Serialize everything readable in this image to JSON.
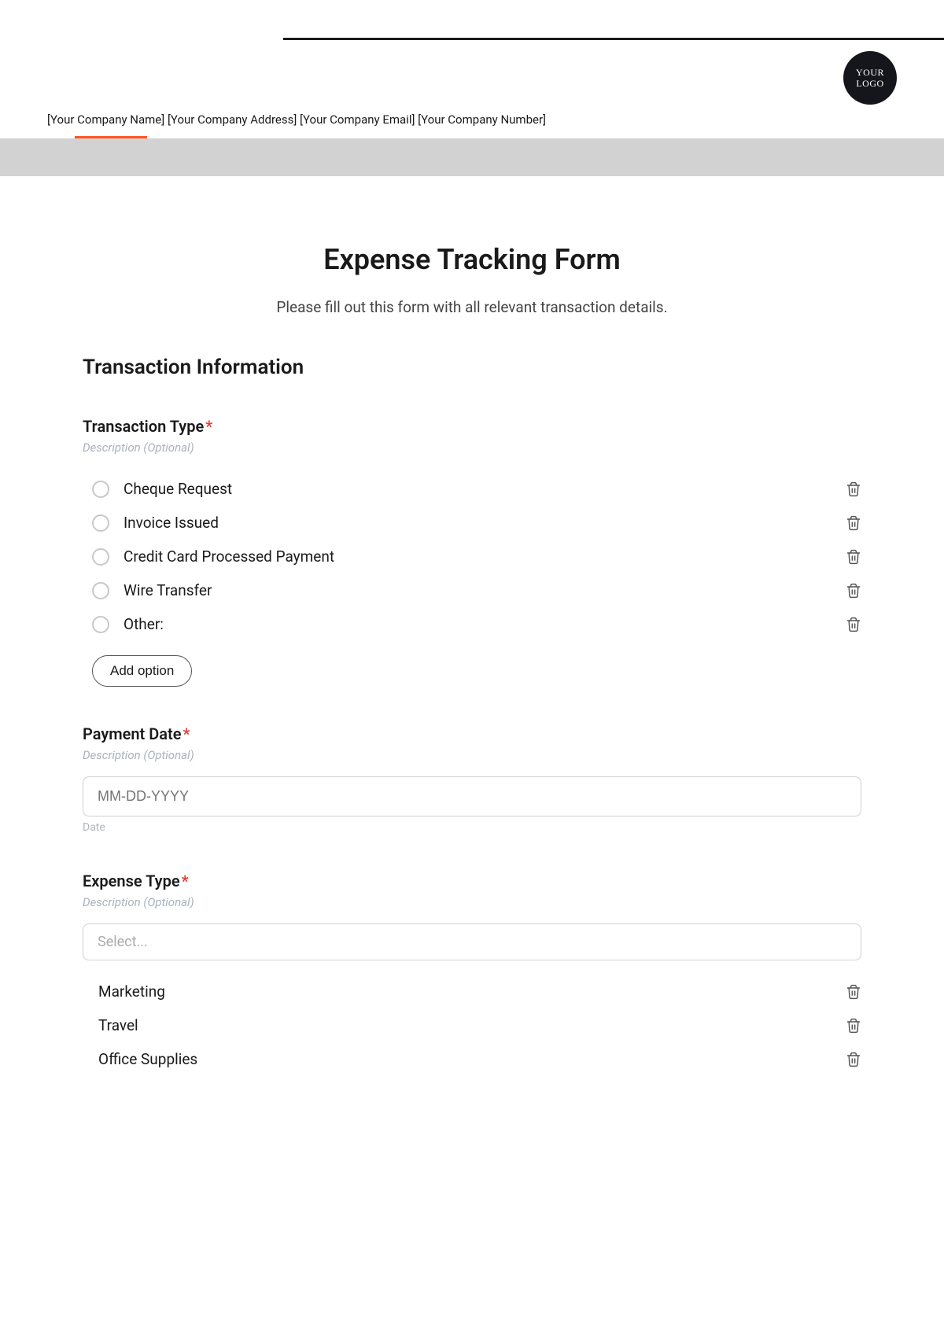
{
  "logo": {
    "line1": "YOUR",
    "line2": "LOGO"
  },
  "company_info": "[Your Company Name] [Your Company Address] [Your Company Email] [Your Company Number]",
  "form_title": "Expense Tracking Form",
  "form_subtitle": "Please fill out this form with all relevant transaction details.",
  "section_title": "Transaction Information",
  "transaction_type": {
    "label": "Transaction Type",
    "description": "Description (Optional)",
    "options": [
      "Cheque Request",
      "Invoice Issued",
      "Credit Card Processed Payment",
      "Wire Transfer",
      "Other:"
    ],
    "add_option": "Add option"
  },
  "payment_date": {
    "label": "Payment Date",
    "description": "Description (Optional)",
    "placeholder": "MM-DD-YYYY",
    "sublabel": "Date"
  },
  "expense_type": {
    "label": "Expense Type",
    "description": "Description (Optional)",
    "select_placeholder": "Select...",
    "options": [
      "Marketing",
      "Travel",
      "Office Supplies"
    ]
  }
}
